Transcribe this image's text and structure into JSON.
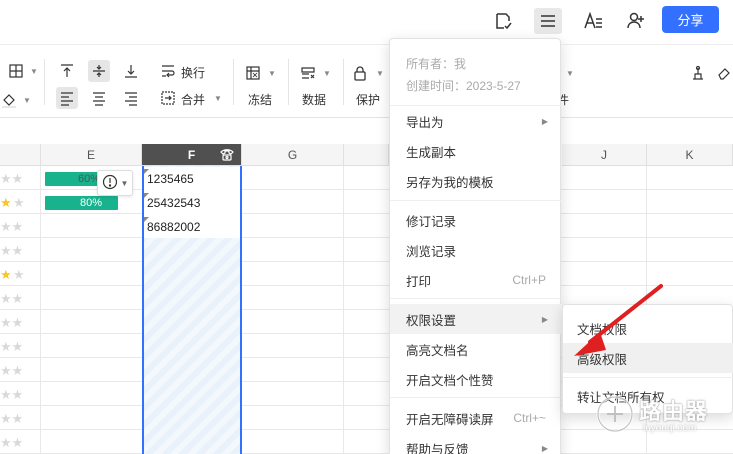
{
  "topbar": {
    "share_label": "分享",
    "icons": [
      "document-check-icon",
      "menu-icon",
      "text-style-icon",
      "add-user-icon"
    ]
  },
  "toolbar": {
    "wrap_label": "换行",
    "merge_label": "合并",
    "freeze_label": "冻结",
    "data_label": "数据",
    "protect_label": "保护",
    "hidden_label": "件"
  },
  "grid": {
    "columns": [
      "E",
      "F",
      "G",
      "J",
      "K"
    ],
    "f_values": [
      "1235465",
      "25432543",
      "86882002"
    ],
    "progress": [
      {
        "label": "60%",
        "value": 0.6
      },
      {
        "label": "80%",
        "value": 0.8
      }
    ]
  },
  "menu": {
    "owner_label": "所有者：我",
    "created_label": "创建时间：2023-5-27",
    "items": [
      {
        "label": "导出为",
        "has_submenu": true
      },
      {
        "label": "生成副本"
      },
      {
        "label": "另存为我的模板"
      },
      {
        "label": "修订记录"
      },
      {
        "label": "浏览记录"
      },
      {
        "label": "打印",
        "shortcut": "Ctrl+P"
      },
      {
        "label": "权限设置",
        "has_submenu": true
      },
      {
        "label": "高亮文档名"
      },
      {
        "label": "开启文档个性赞"
      },
      {
        "label": "开启无障碍读屏",
        "shortcut": "Ctrl+~"
      },
      {
        "label": "帮助与反馈",
        "has_submenu": true
      }
    ]
  },
  "submenu": {
    "items": [
      {
        "label": "文档权限"
      },
      {
        "label": "高级权限"
      },
      {
        "label": "转让文档所有权"
      }
    ]
  },
  "colors": {
    "accent": "#3370ff",
    "progress": "#18b28d",
    "star_on": "#f7c623",
    "arrow": "#e02020"
  },
  "watermark": {
    "text": "路由器",
    "sub": "luyouqi.com"
  }
}
